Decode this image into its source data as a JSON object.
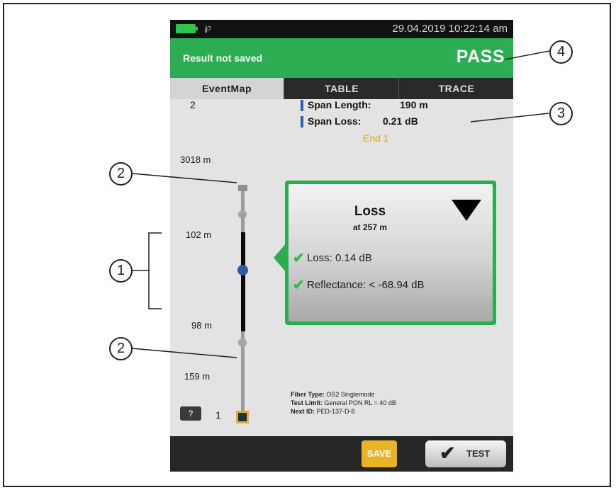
{
  "status_bar": {
    "datetime": "29.04.2019 10:22:14 am",
    "icons": [
      "battery-icon",
      "link-icon"
    ]
  },
  "header": {
    "saved_status": "Result not saved",
    "result": "PASS",
    "color": "#2cad52"
  },
  "tabs": [
    {
      "label": "EventMap",
      "active": true
    },
    {
      "label": "TABLE",
      "active": false
    },
    {
      "label": "TRACE",
      "active": false
    }
  ],
  "span": {
    "length_label": "Span Length:",
    "length_value": "190 m",
    "loss_label": "Span Loss:",
    "loss_value": "0.21 dB",
    "end_label": "End 1"
  },
  "event_map": {
    "top_end": "2",
    "bottom_end": "1",
    "distances": [
      "3018 m",
      "102 m",
      "98 m",
      "159 m"
    ]
  },
  "popup": {
    "title": "Loss",
    "subtitle": "at 257 m",
    "loss": "Loss: 0.14 dB",
    "reflectance": "Reflectance: < -68.94 dB",
    "border_color": "#29ae4f"
  },
  "fiber_info": {
    "fiber_type_label": "Fiber Type:",
    "fiber_type_value": "OS2 Singlemode",
    "test_limit_label": "Test Limit:",
    "test_limit_value": "General PON RL = 40 dB",
    "next_id_label": "Next ID:",
    "next_id_value": "PED-137-D-8"
  },
  "footer": {
    "help_label": "?",
    "save_label": "SAVE",
    "test_label": "TEST"
  },
  "callouts": [
    "1",
    "2",
    "2",
    "3",
    "4"
  ]
}
